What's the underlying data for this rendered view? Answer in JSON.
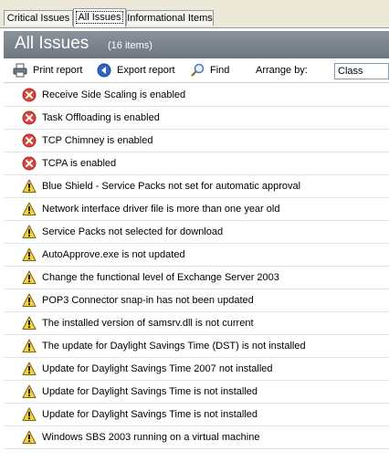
{
  "tabs": [
    {
      "label": "Critical Issues"
    },
    {
      "label": "All Issues"
    },
    {
      "label": "Informational Items"
    }
  ],
  "header": {
    "title": "All Issues",
    "count": "(16 items)"
  },
  "toolbar": {
    "print_label": "Print report",
    "export_label": "Export report",
    "find_label": "Find",
    "arrange_label": "Arrange by:",
    "arrange_value": "Class"
  },
  "issues": [
    {
      "severity": "error",
      "text": "Receive Side Scaling is enabled"
    },
    {
      "severity": "error",
      "text": "Task Offloading is enabled"
    },
    {
      "severity": "error",
      "text": "TCP Chimney is enabled"
    },
    {
      "severity": "error",
      "text": "TCPA is enabled"
    },
    {
      "severity": "warning",
      "text": "Blue Shield - Service Packs not set for automatic approval"
    },
    {
      "severity": "warning",
      "text": "Network interface driver file is more than one year old"
    },
    {
      "severity": "warning",
      "text": "Service Packs not selected for download"
    },
    {
      "severity": "warning",
      "text": "AutoApprove.exe is not updated"
    },
    {
      "severity": "warning",
      "text": "Change the functional level of Exchange Server 2003"
    },
    {
      "severity": "warning",
      "text": "POP3 Connector snap-in has not been updated"
    },
    {
      "severity": "warning",
      "text": "The installed version of samsrv.dll is not current"
    },
    {
      "severity": "warning",
      "text": "The update for Daylight Savings Time (DST) is not installed"
    },
    {
      "severity": "warning",
      "text": "Update for Daylight Savings Time 2007 not installed"
    },
    {
      "severity": "warning",
      "text": "Update for Daylight Savings Time is not installed"
    },
    {
      "severity": "warning",
      "text": "Update for Daylight Savings Time is not installed"
    },
    {
      "severity": "warning",
      "text": "Windows SBS 2003 running on a virtual machine"
    }
  ]
}
